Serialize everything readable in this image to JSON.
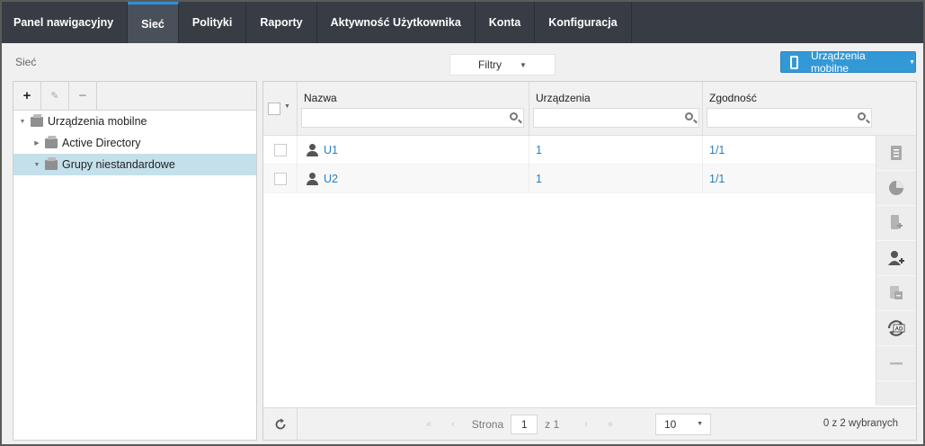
{
  "nav": {
    "tabs": [
      {
        "label": "Panel nawigacyjny"
      },
      {
        "label": "Sieć"
      },
      {
        "label": "Polityki"
      },
      {
        "label": "Raporty"
      },
      {
        "label": "Aktywność Użytkownika"
      },
      {
        "label": "Konta"
      },
      {
        "label": "Konfiguracja"
      }
    ],
    "active": "Sieć"
  },
  "breadcrumb": "Sieć",
  "filter": {
    "label": "Filtry"
  },
  "mobile_button": {
    "label": "Urządzenia mobilne",
    "icon": "phone-icon"
  },
  "tree": {
    "toolbar": [
      {
        "icon": "plus-icon",
        "symbol": "+"
      },
      {
        "icon": "pencil-icon",
        "symbol": "✎"
      },
      {
        "icon": "minus-icon",
        "symbol": "−"
      }
    ],
    "items": [
      {
        "label": "Urządzenia mobilne",
        "expanded": true,
        "selected": false
      },
      {
        "label": "Active Directory",
        "expanded": false,
        "selected": false
      },
      {
        "label": "Grupy niestandardowe",
        "expanded": true,
        "selected": true
      }
    ]
  },
  "grid": {
    "columns": [
      {
        "label": "Nazwa"
      },
      {
        "label": "Urządzenia"
      },
      {
        "label": "Zgodność"
      }
    ],
    "rows": [
      {
        "name": "U1",
        "devices": "1",
        "compliance": "1/1"
      },
      {
        "name": "U2",
        "devices": "1",
        "compliance": "1/1"
      }
    ],
    "side_actions": [
      "report-icon",
      "pie-chart-icon",
      "add-device-icon",
      "add-user-icon",
      "assign-icon",
      "sync-ad-icon",
      "remove-icon"
    ],
    "accent_color": "#2a7fc0"
  },
  "pagination": {
    "page_label": "Strona",
    "page": "1",
    "of_label": "z 1",
    "per_page": "10",
    "selected_summary": "0 z 2 wybranych"
  }
}
